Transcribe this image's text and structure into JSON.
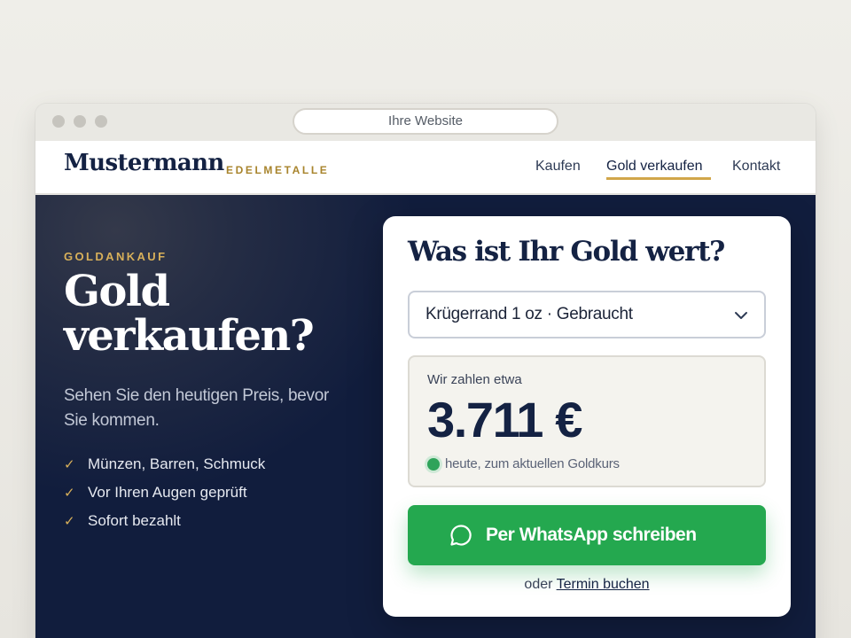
{
  "browser": {
    "url_label": "Ihre Website"
  },
  "header": {
    "brand_name": "Mustermann",
    "brand_suffix": "EDELMETALLE",
    "nav": [
      {
        "label": "Kaufen",
        "active": false
      },
      {
        "label": "Gold verkaufen",
        "active": true
      },
      {
        "label": "Kontakt",
        "active": false
      }
    ]
  },
  "hero": {
    "eyebrow": "GOLDANKAUF",
    "headline_line1": "Gold",
    "headline_line2": "verkaufen?",
    "subtext": "Sehen Sie den heutigen Preis, bevor Sie kommen.",
    "features": [
      "Münzen, Barren, Schmuck",
      "Vor Ihren Augen geprüft",
      "Sofort bezahlt"
    ]
  },
  "card": {
    "title": "Was ist Ihr Gold wert?",
    "select_value": "Krügerrand 1 oz · Gebraucht",
    "quote_label": "Wir zahlen etwa",
    "quote_price": "3.711 €",
    "quote_note": "heute, zum aktuellen Goldkurs",
    "cta_label": "Per WhatsApp schreiben",
    "alt_prefix": "oder",
    "alt_link": "Termin buchen"
  },
  "colors": {
    "navy": "#142243",
    "hero_bg": "#111d3d",
    "gold_accent": "#d1a64a",
    "whatsapp_green": "#24a84f"
  },
  "icons": {
    "check": "check-icon",
    "select": "chevron-down-icon",
    "cta": "whatsapp-icon",
    "status": "live-dot-icon"
  }
}
